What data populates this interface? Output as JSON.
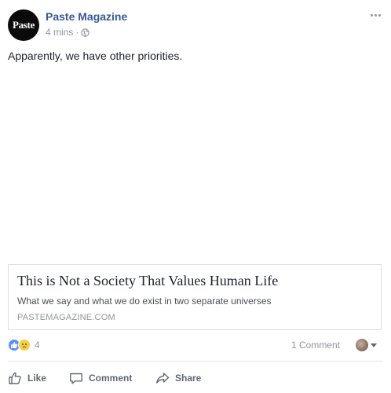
{
  "post": {
    "page_name": "Paste Magazine",
    "avatar_text": "Paste",
    "time": "4 mins",
    "separator": "·",
    "privacy_icon": "globe-icon",
    "more_icon": "more-options-icon",
    "text": "Apparently, we have other priorities."
  },
  "link_preview": {
    "title": "This is Not a Society That Values Human Life",
    "description": "What we say and what we do exist in two separate universes",
    "domain": "PASTEMAGAZINE.COM"
  },
  "reactions": {
    "icons": [
      "like-icon",
      "sad-icon"
    ],
    "count": "4",
    "comments": "1 Comment"
  },
  "actions": {
    "like_label": "Like",
    "comment_label": "Comment",
    "share_label": "Share"
  },
  "colors": {
    "link": "#365899",
    "meta": "#90949c",
    "text": "#1d2129",
    "like_blue": "#5890ff",
    "sad_yellow": "#f7d046",
    "border": "#dddfe2"
  }
}
